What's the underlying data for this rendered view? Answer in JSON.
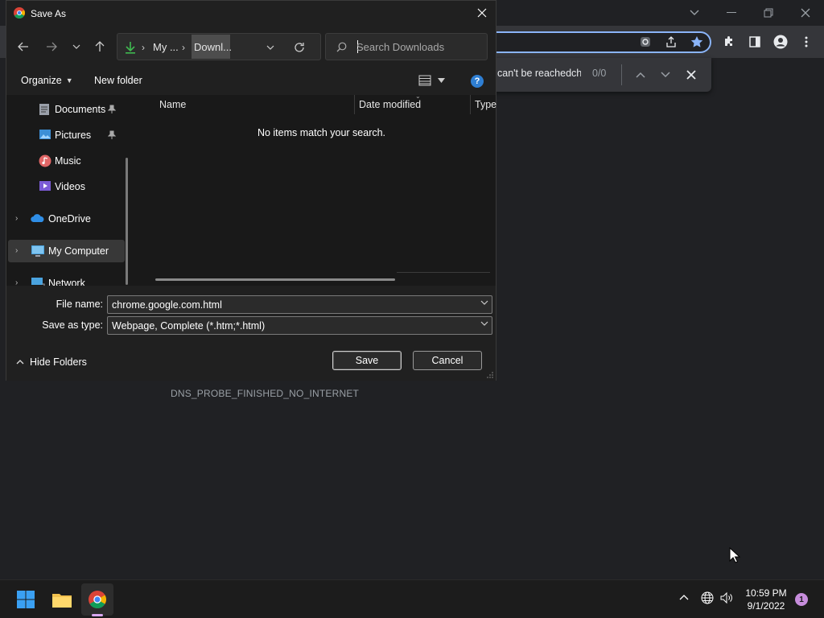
{
  "chrome": {
    "find": {
      "query": "can't be reachedchı",
      "count": "0/0"
    },
    "error_code": "DNS_PROBE_FINISHED_NO_INTERNET"
  },
  "dialog": {
    "title": "Save As",
    "address": {
      "crumb1": "My ...",
      "crumb2": "Downl..."
    },
    "search_placeholder": "Search Downloads",
    "toolbar": {
      "organize": "Organize",
      "new_folder": "New folder"
    },
    "nav": [
      {
        "label": "Documents"
      },
      {
        "label": "Pictures"
      },
      {
        "label": "Music"
      },
      {
        "label": "Videos"
      },
      {
        "label": "OneDrive"
      },
      {
        "label": "My Computer"
      },
      {
        "label": "Network"
      }
    ],
    "columns": [
      "Name",
      "Date modified",
      "Type"
    ],
    "empty_message": "No items match your search.",
    "file_name_label": "File name:",
    "file_name_value": "chrome.google.com.html",
    "save_type_label": "Save as type:",
    "save_type_value": "Webpage, Complete (*.htm;*.html)",
    "hide_folders": "Hide Folders",
    "save_button": "Save",
    "cancel_button": "Cancel",
    "help_glyph": "?"
  },
  "taskbar": {
    "time": "10:59 PM",
    "date": "9/1/2022",
    "notification_count": "1"
  },
  "colors": {
    "dialog_bg": "#191919",
    "chrome_bg": "#202124",
    "accent_blue": "#8ab4f8",
    "download_green": "#3fb950"
  }
}
